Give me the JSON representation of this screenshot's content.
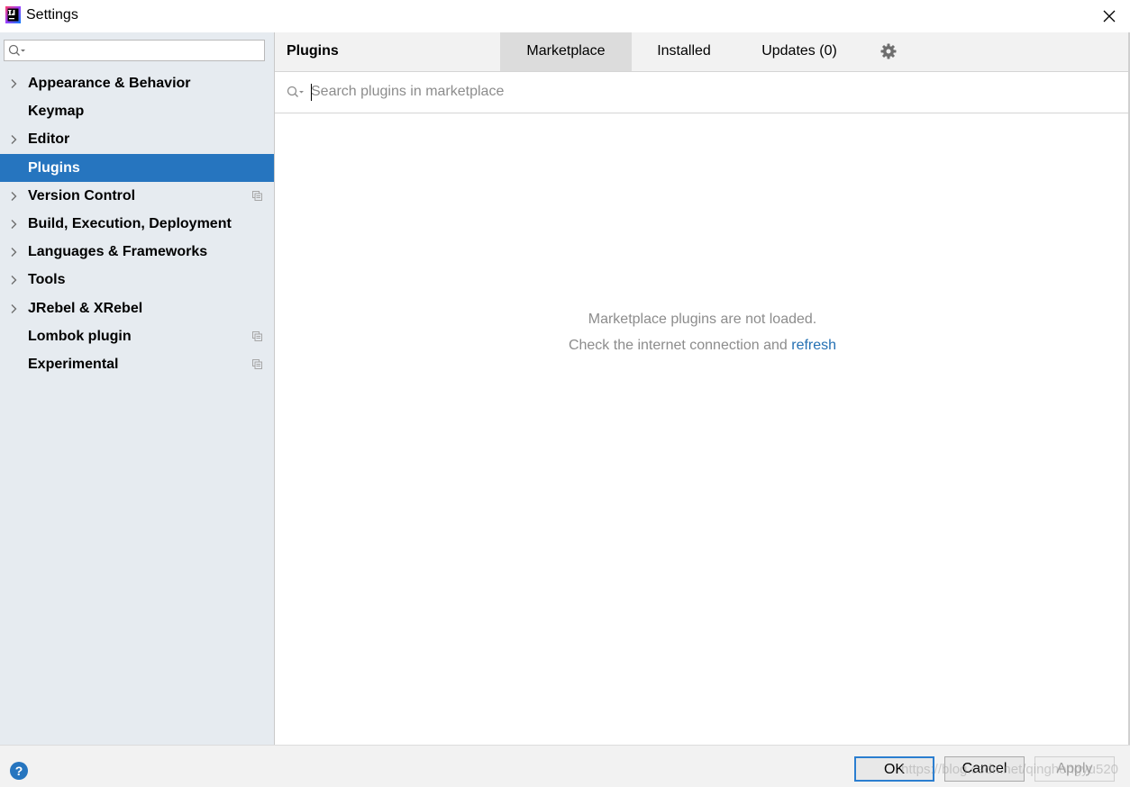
{
  "window": {
    "title": "Settings",
    "app_icon": "intellij-idea-icon",
    "close_icon": "close-icon"
  },
  "sidebar": {
    "search_icon": "search-icon",
    "search_value": "",
    "items": [
      {
        "label": "Appearance & Behavior",
        "expandable": true,
        "project_icon": false,
        "selected": false
      },
      {
        "label": "Keymap",
        "expandable": false,
        "project_icon": false,
        "selected": false
      },
      {
        "label": "Editor",
        "expandable": true,
        "project_icon": false,
        "selected": false
      },
      {
        "label": "Plugins",
        "expandable": false,
        "project_icon": false,
        "selected": true
      },
      {
        "label": "Version Control",
        "expandable": true,
        "project_icon": true,
        "selected": false
      },
      {
        "label": "Build, Execution, Deployment",
        "expandable": true,
        "project_icon": false,
        "selected": false
      },
      {
        "label": "Languages & Frameworks",
        "expandable": true,
        "project_icon": false,
        "selected": false
      },
      {
        "label": "Tools",
        "expandable": true,
        "project_icon": false,
        "selected": false
      },
      {
        "label": "JRebel & XRebel",
        "expandable": true,
        "project_icon": false,
        "selected": false
      },
      {
        "label": "Lombok plugin",
        "expandable": false,
        "project_icon": true,
        "selected": false
      },
      {
        "label": "Experimental",
        "expandable": false,
        "project_icon": true,
        "selected": false
      }
    ]
  },
  "main": {
    "title": "Plugins",
    "tabs": [
      {
        "label": "Marketplace",
        "active": true
      },
      {
        "label": "Installed",
        "active": false
      },
      {
        "label": "Updates (0)",
        "active": false
      }
    ],
    "settings_icon": "gear-icon",
    "search": {
      "placeholder": "Search plugins in marketplace",
      "value": "",
      "icon": "search-icon"
    },
    "empty_state": {
      "line1": "Marketplace plugins are not loaded.",
      "line2_prefix": "Check the internet connection and ",
      "line2_link": "refresh"
    }
  },
  "footer": {
    "help_icon": "help-icon",
    "help_glyph": "?",
    "ok_label": "OK",
    "cancel_label": "Cancel",
    "apply_label": "Apply",
    "watermark": "https://blog.csdn.net/qinghongyu520"
  },
  "colors": {
    "selection": "#2675bf",
    "sidebar_bg": "#e6ebf0",
    "link": "#2470b3",
    "muted_text": "#8c8c8c"
  }
}
